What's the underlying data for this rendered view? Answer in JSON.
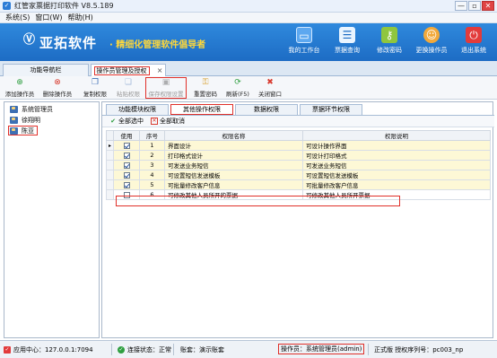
{
  "window": {
    "title": "红管家票据打印软件 V8.5.189",
    "minimize": "—",
    "restore": "▫",
    "close": "✕"
  },
  "menu": [
    "系统(S)",
    "窗口(W)",
    "帮助(H)"
  ],
  "brand": {
    "name": "亚拓软件",
    "dot": "·",
    "slogan": "精细化管理软件倡导者"
  },
  "topbuttons": [
    {
      "label": "我的工作台",
      "icon": "monitor-icon",
      "glyph": "▭",
      "color": "#5da8f0"
    },
    {
      "label": "票据查询",
      "icon": "list-icon",
      "glyph": "☰",
      "color": "#6fb6f2"
    },
    {
      "label": "修改密码",
      "icon": "lock-icon",
      "glyph": "🔒",
      "color": "#8fc63e"
    },
    {
      "label": "更换操作员",
      "icon": "user-icon",
      "glyph": "☺",
      "color": "#f2a93b"
    },
    {
      "label": "退出系统",
      "icon": "power-icon",
      "glyph": "⏻",
      "color": "#e23b3b"
    }
  ],
  "maintabs": [
    {
      "label": "功能导航栏"
    },
    {
      "label": "操作员管理及授权",
      "close": "×"
    }
  ],
  "toolbar": [
    {
      "label": "添加操作员",
      "icon": "add-icon",
      "glyph": "⊕",
      "color": "#2e9e3f",
      "disabled": false
    },
    {
      "label": "删除操作员",
      "icon": "delete-icon",
      "glyph": "⊗",
      "color": "#d83a2e",
      "disabled": false
    },
    {
      "label": "复制权限",
      "icon": "copy-icon",
      "glyph": "❐",
      "color": "#3e6fb5",
      "disabled": false
    },
    {
      "label": "粘贴权限",
      "icon": "paste-icon",
      "glyph": "❏",
      "color": "#3e6fb5",
      "disabled": true
    },
    {
      "label": "保存权限设置",
      "icon": "save-icon",
      "glyph": "▣",
      "color": "#555",
      "disabled": true
    },
    {
      "label": "重置密码",
      "icon": "key-icon",
      "glyph": "⚿",
      "color": "#d69a1e",
      "disabled": false
    },
    {
      "label": "刷新(F5)",
      "icon": "refresh-icon",
      "glyph": "⟳",
      "color": "#2e9e3f",
      "disabled": false
    },
    {
      "label": "关闭窗口",
      "icon": "close-window-icon",
      "glyph": "✖",
      "color": "#d83a2e",
      "disabled": false
    }
  ],
  "users": [
    "系统管理员",
    "徐翔明",
    "陈亚"
  ],
  "subtabs": [
    "功能模块权限",
    "其他操作权限",
    "数据权限",
    "票据环节权限"
  ],
  "selection": {
    "select_all": "全部选中",
    "cancel_all": "全部取消"
  },
  "grid": {
    "headers": [
      "",
      "使用",
      "序号",
      "权限名称",
      "权限说明"
    ],
    "rows": [
      {
        "marker": "▸",
        "checked": true,
        "no": "1",
        "name": "界面设计",
        "desc": "可设计操作界面"
      },
      {
        "marker": "",
        "checked": true,
        "no": "2",
        "name": "打印格式设计",
        "desc": "可设计打印格式"
      },
      {
        "marker": "",
        "checked": true,
        "no": "3",
        "name": "可发送业务短信",
        "desc": "可发送业务短信"
      },
      {
        "marker": "",
        "checked": true,
        "no": "4",
        "name": "可设置短信发送模板",
        "desc": "可设置短信发送模板"
      },
      {
        "marker": "",
        "checked": true,
        "no": "5",
        "name": "可批量修改客户信息",
        "desc": "可批量修改客户信息"
      },
      {
        "marker": "",
        "checked": false,
        "no": "6",
        "name": "可修改其他人员所开的票据",
        "desc": "可修改其他人员所开票据"
      }
    ]
  },
  "status": {
    "app_center": "应用中心：127.0.0.1:7094",
    "connection": "连接状态：正常",
    "account": "账套：演示账套",
    "operator": "操作员：系统管理员(admin)",
    "edition": "正式版 授权序列号：pc003_np"
  }
}
